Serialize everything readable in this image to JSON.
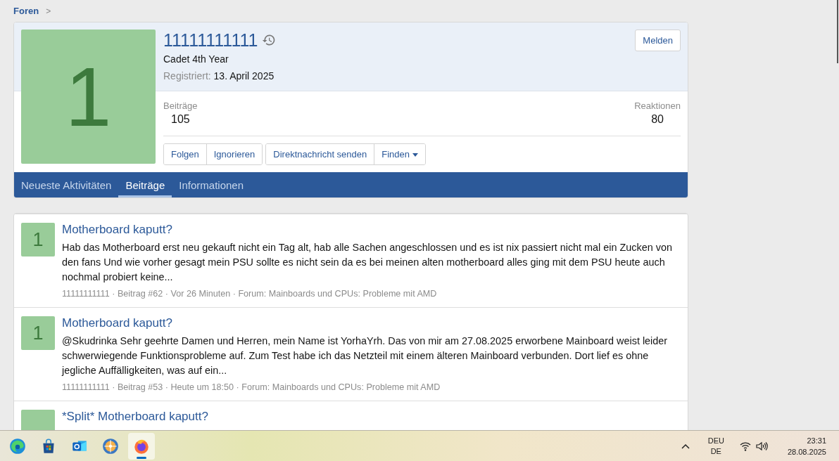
{
  "breadcrumb": {
    "items": [
      {
        "label": "Foren",
        "separator": ">"
      }
    ]
  },
  "profile": {
    "avatar_letter": "1",
    "username": "11111111111",
    "user_title": "Cadet 4th Year",
    "registered_label": "Registriert:",
    "registered_value": "13. April 2025",
    "report_button": "Melden",
    "stats": [
      {
        "label": "Beiträge",
        "value": "105"
      },
      {
        "label": "Reaktionen",
        "value": "80"
      }
    ],
    "button_groups": [
      [
        "Folgen",
        "Ignorieren"
      ],
      [
        "Direktnachricht senden",
        "Finden"
      ]
    ],
    "tabs": [
      {
        "label": "Neueste Aktivitäten",
        "selected": false
      },
      {
        "label": "Beiträge",
        "selected": true
      },
      {
        "label": "Informationen",
        "selected": false
      }
    ]
  },
  "posts": [
    {
      "avatar_letter": "1",
      "title": "Motherboard kaputt?",
      "snippet": "Hab das Motherboard erst neu gekauft nicht ein Tag alt, hab alle Sachen angeschlossen und es ist nix passiert nicht mal ein Zucken von den fans Und wie vorher gesagt mein PSU sollte es nicht sein da es bei meinen alten motherboard alles ging mit dem PSU heute auch nochmal probiert keine...",
      "meta": "11111111111 · Beitrag #62 · Vor 26 Minuten · Forum: Mainboards und CPUs: Probleme mit AMD"
    },
    {
      "avatar_letter": "1",
      "title": "Motherboard kaputt?",
      "snippet": "@Skudrinka Sehr geehrte Damen und Herren, mein Name ist YorhaYrh. Das von mir am 27.08.2025 erworbene Mainboard weist leider schwerwiegende Funktionsprobleme auf. Zum Test habe ich das Netzteil mit einem älteren Mainboard verbunden. Dort lief es ohne jegliche Auffälligkeiten, was auf ein...",
      "meta": "11111111111 · Beitrag #53 · Heute um 18:50 · Forum: Mainboards und CPUs: Probleme mit AMD"
    },
    {
      "title": "*Split* Motherboard kaputt?"
    }
  ],
  "taskbar": {
    "apps": [
      {
        "kind": "edge",
        "selected": false
      },
      {
        "kind": "store",
        "selected": false
      },
      {
        "kind": "outlook",
        "selected": false
      },
      {
        "kind": "compass",
        "selected": false
      },
      {
        "kind": "firefox",
        "selected": true
      }
    ],
    "language": [
      "DEU",
      "DE"
    ],
    "time": "23:31",
    "date": "28.08.2025"
  }
}
